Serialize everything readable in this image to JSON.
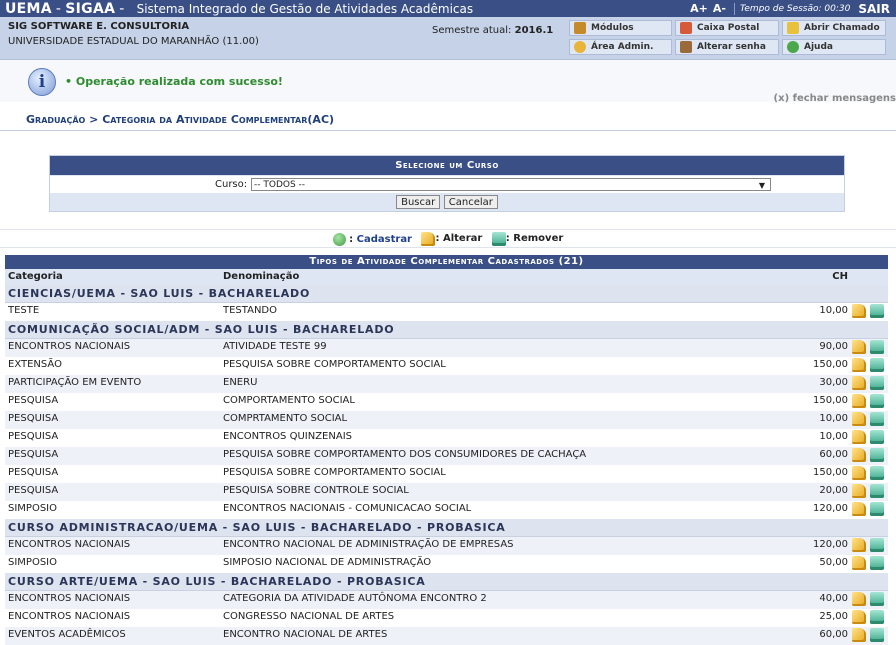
{
  "header": {
    "brand_uema": "UEMA",
    "brand_sep": "-",
    "brand_sigaa": "SIGAA",
    "brand_sep2": "-",
    "system_title": "Sistema Integrado de Gestão de Atividades Acadêmicas",
    "font_plus": "A+",
    "font_minus": "A-",
    "session": "Tempo de Sessão: 00:30",
    "logout": "SAIR"
  },
  "info": {
    "org": "SIG SOFTWARE E. CONSULTORIA",
    "university": "UNIVERSIDADE ESTADUAL DO MARANHÃO (11.00)",
    "semester_label": "Semestre atual:",
    "semester_value": "2016.1",
    "menu": {
      "modulos": "Módulos",
      "caixa_postal": "Caixa Postal",
      "abrir_chamado": "Abrir Chamado",
      "area_admin": "Área Admin.",
      "alterar_senha": "Alterar senha",
      "ajuda": "Ajuda"
    }
  },
  "message": {
    "text": "Operação realizada com sucesso!",
    "close": "(x) fechar mensagens"
  },
  "breadcrumb": "Graduação > Categoria da Atividade Complementar(AC)",
  "form": {
    "caption": "Selecione um Curso",
    "curso_label": "Curso:",
    "curso_value": "-- TODOS --",
    "buscar": "Buscar",
    "cancelar": "Cancelar"
  },
  "legend": {
    "cadastrar": "Cadastrar",
    "alterar": ": Alterar",
    "remover": ": Remover",
    "colon": ":"
  },
  "table": {
    "caption": "Tipos de Atividade Complementar Cadastrados (21)",
    "headers": {
      "categoria": "Categoria",
      "denominacao": "Denominação",
      "ch": "CH"
    },
    "groups": [
      {
        "name": "CIENCIAS/UEMA - SAO LUIS - BACHARELADO",
        "rows": [
          {
            "categoria": "TESTE",
            "denominacao": "TESTANDO",
            "ch": "10,00"
          }
        ]
      },
      {
        "name": "COMUNICAÇÃO SOCIAL/ADM - SAO LUIS - BACHARELADO",
        "rows": [
          {
            "categoria": "ENCONTROS NACIONAIS",
            "denominacao": "ATIVIDADE TESTE 99",
            "ch": "90,00"
          },
          {
            "categoria": "EXTENSÃO",
            "denominacao": "PESQUISA SOBRE COMPORTAMENTO SOCIAL",
            "ch": "150,00"
          },
          {
            "categoria": "PARTICIPAÇÃO EM EVENTO",
            "denominacao": "ENERU",
            "ch": "30,00"
          },
          {
            "categoria": "PESQUISA",
            "denominacao": "COMPORTAMENTO SOCIAL",
            "ch": "150,00"
          },
          {
            "categoria": "PESQUISA",
            "denominacao": "COMPRTAMENTO SOCIAL",
            "ch": "10,00"
          },
          {
            "categoria": "PESQUISA",
            "denominacao": "ENCONTROS QUINZENAIS",
            "ch": "10,00"
          },
          {
            "categoria": "PESQUISA",
            "denominacao": "PESQUISA SOBRE COMPORTAMENTO DOS CONSUMIDORES DE CACHAÇA",
            "ch": "60,00"
          },
          {
            "categoria": "PESQUISA",
            "denominacao": "PESQUISA SOBRE COMPORTAMENTO SOCIAL",
            "ch": "150,00"
          },
          {
            "categoria": "PESQUISA",
            "denominacao": "PESQUISA SOBRE CONTROLE SOCIAL",
            "ch": "20,00"
          },
          {
            "categoria": "SIMPOSIO",
            "denominacao": "ENCONTROS NACIONAIS - COMUNICACAO SOCIAL",
            "ch": "120,00"
          }
        ]
      },
      {
        "name": "CURSO ADMINISTRACAO/UEMA - SAO LUIS - BACHARELADO - PROBASICA",
        "rows": [
          {
            "categoria": "ENCONTROS NACIONAIS",
            "denominacao": "ENCONTRO NACIONAL DE ADMINISTRAÇÃO DE EMPRESAS",
            "ch": "120,00"
          },
          {
            "categoria": "SIMPOSIO",
            "denominacao": "SIMPOSIO NACIONAL DE ADMINISTRAÇÃO",
            "ch": "50,00"
          }
        ]
      },
      {
        "name": "CURSO ARTE/UEMA - SAO LUIS - BACHARELADO - PROBASICA",
        "rows": [
          {
            "categoria": "ENCONTROS NACIONAIS",
            "denominacao": "CATEGORIA DA ATIVIDADE AUTÔNOMA ENCONTRO 2",
            "ch": "40,00"
          },
          {
            "categoria": "ENCONTROS NACIONAIS",
            "denominacao": "CONGRESSO NACIONAL DE ARTES",
            "ch": "25,00"
          },
          {
            "categoria": "EVENTOS ACADÊMICOS",
            "denominacao": "ENCONTRO NACIONAL DE ARTES",
            "ch": "60,00"
          }
        ]
      }
    ]
  }
}
